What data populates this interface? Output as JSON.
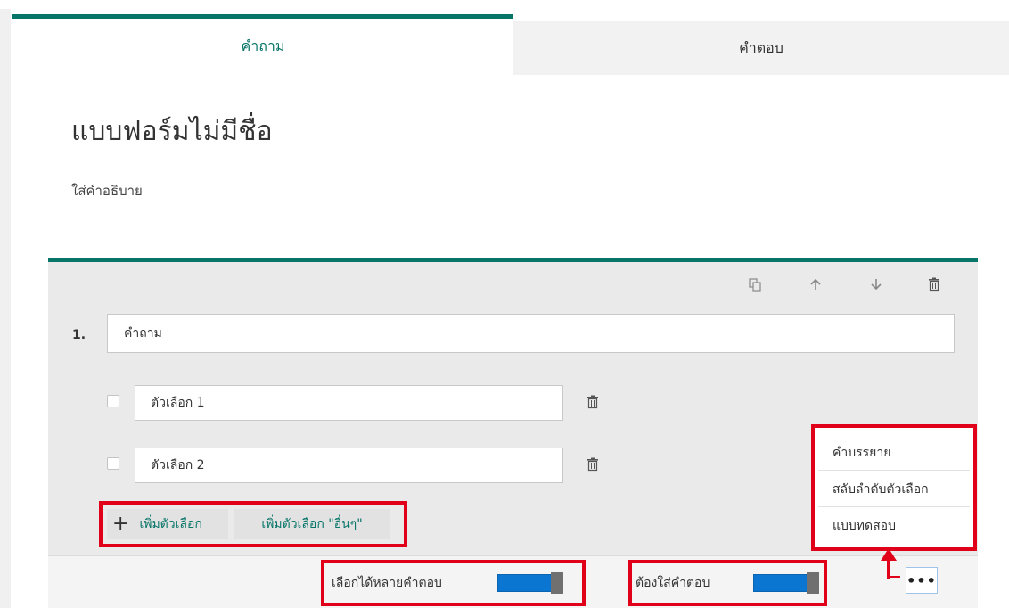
{
  "tabs": {
    "questions": "คำถาม",
    "responses": "คำตอบ"
  },
  "form": {
    "title": "แบบฟอร์มไม่มีชื่อ",
    "description": "ใส่คำอธิบาย"
  },
  "question": {
    "number": "1.",
    "title": "คำถาม",
    "toolbar_icons": [
      "copy-icon",
      "arrow-up-icon",
      "arrow-down-icon",
      "trash-icon"
    ],
    "options": [
      {
        "label": "ตัวเลือก 1"
      },
      {
        "label": "ตัวเลือก 2"
      }
    ],
    "add_option": "เพิ่มตัวเลือก",
    "add_other": "เพิ่มตัวเลือก \"อื่นๆ\"",
    "multi_answer_label": "เลือกได้หลายคำตอบ",
    "required_label": "ต้องใส่คำตอบ",
    "more_label": "•••"
  },
  "more_menu": {
    "items": [
      "คำบรรยาย",
      "สลับลำดับตัวเลือก",
      "แบบทดสอบ"
    ]
  },
  "colors": {
    "accent": "#077568",
    "highlight": "#e0001a",
    "toggle": "#0a76d1"
  }
}
